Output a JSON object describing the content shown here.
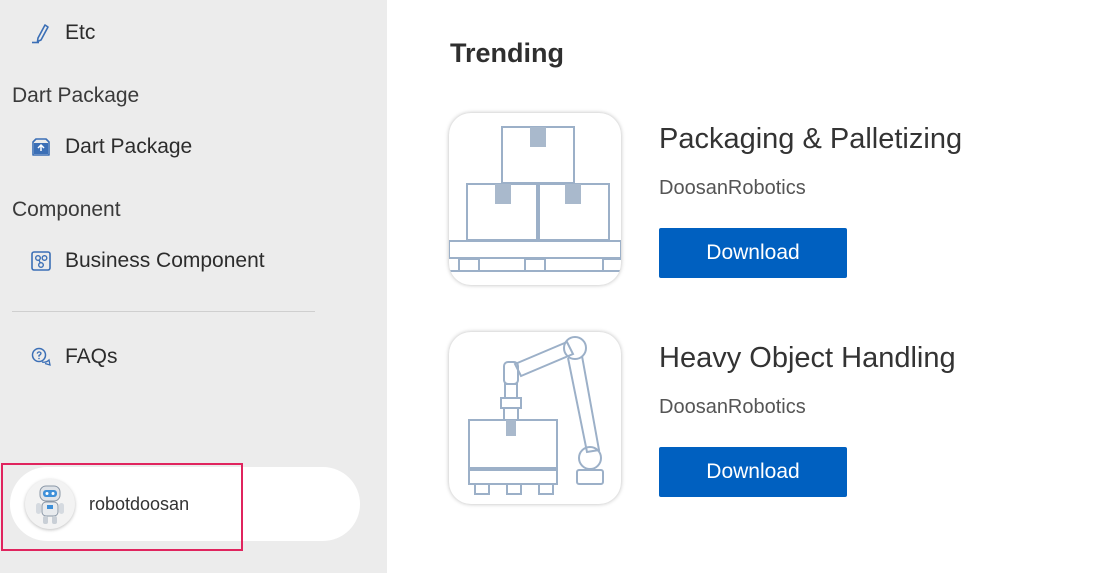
{
  "sidebar": {
    "items": [
      {
        "label": "Etc",
        "icon": "pen-icon"
      },
      {
        "label": "Dart Package",
        "icon": "package-icon"
      },
      {
        "label": "Business Component",
        "icon": "component-icon"
      },
      {
        "label": "FAQs",
        "icon": "faq-icon"
      }
    ],
    "sections": [
      "Dart Package",
      "Component"
    ],
    "user": {
      "name": "robotdoosan",
      "avatar": "robot-avatar"
    }
  },
  "main": {
    "heading": "Trending",
    "apps": [
      {
        "title": "Packaging & Palletizing",
        "author": "DoosanRobotics",
        "button_label": "Download",
        "thumbnail": "boxes-on-pallet-icon"
      },
      {
        "title": "Heavy Object Handling",
        "author": "DoosanRobotics",
        "button_label": "Download",
        "thumbnail": "robot-arm-lifting-box-icon"
      }
    ]
  },
  "colors": {
    "sidebar_bg": "#ececec",
    "accent": "#0060c0",
    "icon_blue": "#3b6fb6",
    "thumb_line": "#9cb0c8",
    "thumb_fill": "#a9b9cc",
    "highlight": "#e0245e"
  }
}
